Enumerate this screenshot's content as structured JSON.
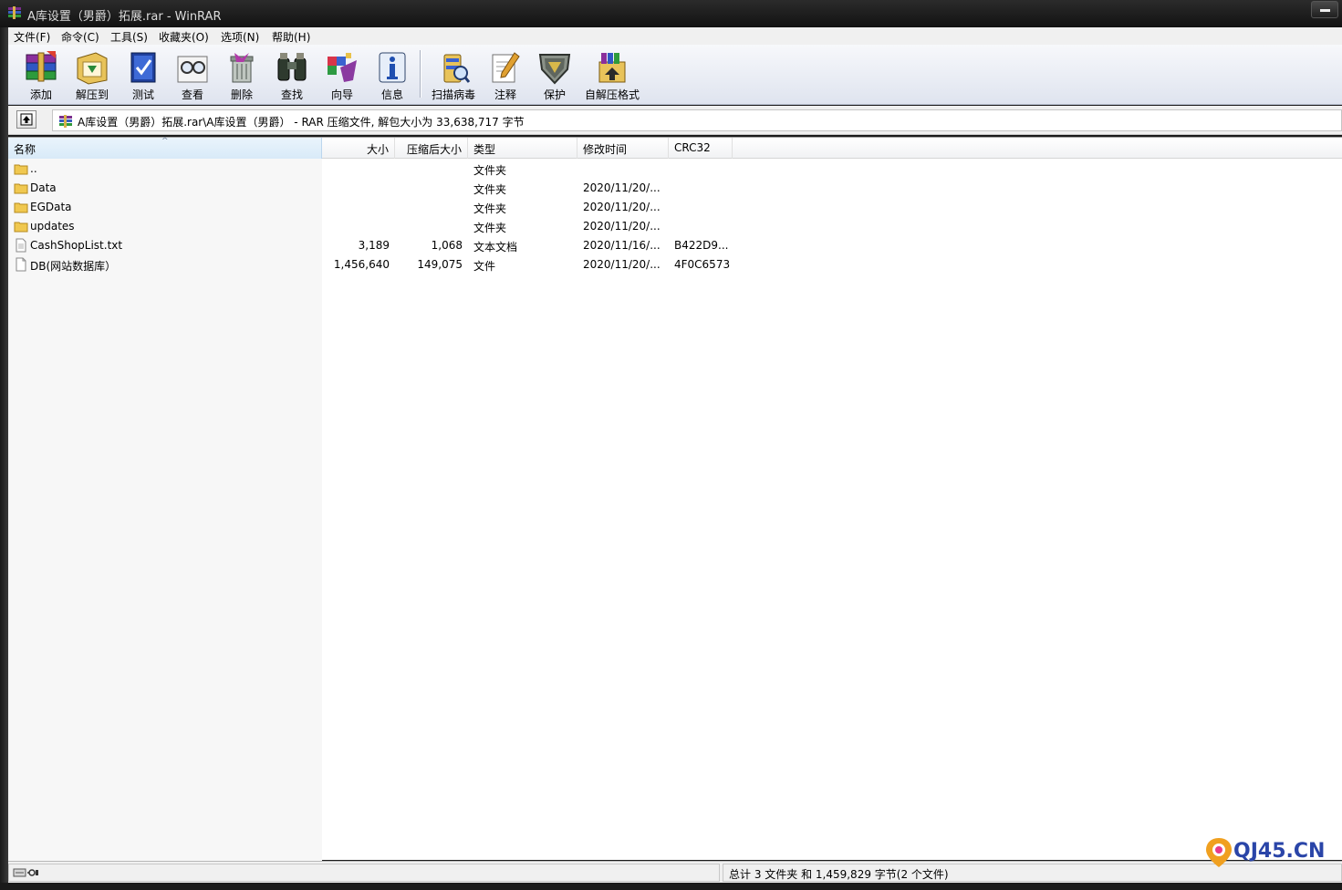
{
  "window": {
    "title": "A库设置（男爵）拓展.rar - WinRAR",
    "icon": "winrar-books-icon"
  },
  "menu": [
    {
      "label": "文件(F)"
    },
    {
      "label": "命令(C)"
    },
    {
      "label": "工具(S)"
    },
    {
      "label": "收藏夹(O)"
    },
    {
      "label": "选项(N)"
    },
    {
      "label": "帮助(H)"
    }
  ],
  "toolbar": [
    {
      "label": "添加",
      "icon": "add-icon"
    },
    {
      "label": "解压到",
      "icon": "extract-to-icon"
    },
    {
      "label": "测试",
      "icon": "test-icon"
    },
    {
      "label": "查看",
      "icon": "view-icon"
    },
    {
      "label": "删除",
      "icon": "delete-icon"
    },
    {
      "label": "查找",
      "icon": "find-icon"
    },
    {
      "label": "向导",
      "icon": "wizard-icon"
    },
    {
      "label": "信息",
      "icon": "info-icon"
    },
    {
      "label": "扫描病毒",
      "icon": "scan-virus-icon"
    },
    {
      "label": "注释",
      "icon": "comment-icon"
    },
    {
      "label": "保护",
      "icon": "protect-icon"
    },
    {
      "label": "自解压格式",
      "icon": "sfx-icon"
    }
  ],
  "address": {
    "text": "A库设置（男爵）拓展.rar\\A库设置（男爵） - RAR 压缩文件, 解包大小为 33,638,717 字节"
  },
  "columns": {
    "name": "名称",
    "size": "大小",
    "packed": "压缩后大小",
    "type": "类型",
    "modified": "修改时间",
    "crc": "CRC32"
  },
  "files": [
    {
      "name": "..",
      "size": "",
      "packed": "",
      "type": "文件夹",
      "modified": "",
      "crc": "",
      "icon": "folder-icon"
    },
    {
      "name": "Data",
      "size": "",
      "packed": "",
      "type": "文件夹",
      "modified": "2020/11/20/...",
      "crc": "",
      "icon": "folder-icon"
    },
    {
      "name": "EGData",
      "size": "",
      "packed": "",
      "type": "文件夹",
      "modified": "2020/11/20/...",
      "crc": "",
      "icon": "folder-icon"
    },
    {
      "name": "updates",
      "size": "",
      "packed": "",
      "type": "文件夹",
      "modified": "2020/11/20/...",
      "crc": "",
      "icon": "folder-icon"
    },
    {
      "name": "CashShopList.txt",
      "size": "3,189",
      "packed": "1,068",
      "type": "文本文档",
      "modified": "2020/11/16/...",
      "crc": "B422D9...",
      "icon": "text-file-icon"
    },
    {
      "name": "DB(网站数据库）",
      "size": "1,456,640",
      "packed": "149,075",
      "type": "文件",
      "modified": "2020/11/20/...",
      "crc": "4F0C6573",
      "icon": "file-icon"
    }
  ],
  "status": {
    "summary": "总计 3 文件夹 和 1,459,829 字节(2 个文件)"
  },
  "watermark": {
    "text": "QJ45.CN"
  },
  "colors": {
    "toolbar_bg": "#dfe4ef",
    "selected_column": "#d8eaf8",
    "title_bar": "#121212",
    "watermark": "#2a45a8"
  }
}
